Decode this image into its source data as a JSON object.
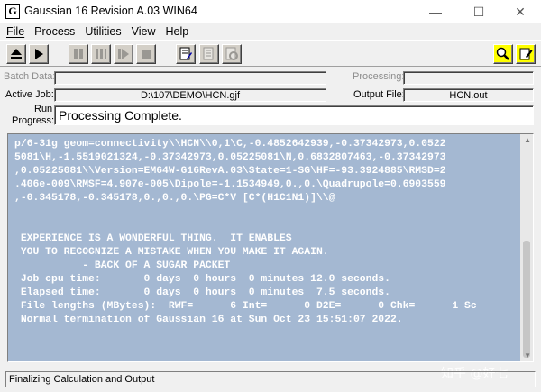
{
  "window": {
    "icon_glyph": "G",
    "title": "Gaussian 16 Revision A.03 WIN64",
    "minimize_glyph": "—",
    "maximize_glyph": "☐",
    "close_glyph": "✕"
  },
  "menu": [
    {
      "label": "File"
    },
    {
      "label": "Process"
    },
    {
      "label": "Utilities"
    },
    {
      "label": "View"
    },
    {
      "label": "Help"
    }
  ],
  "toolbar": {
    "icons": [
      "eject-icon",
      "play-icon",
      "pause-icon",
      "pause-after-icon",
      "skip-icon",
      "stop-icon",
      "edit-route-icon",
      "edit-batch-icon",
      "edit-config-icon",
      "search-icon",
      "edit-note-icon"
    ]
  },
  "fields": {
    "batch_data_label": "Batch Data:",
    "batch_data_value": "",
    "processing_label": "Processing:",
    "processing_value": "",
    "active_job_label": "Active Job:",
    "active_job_value": "D:\\107\\DEMO\\HCN.gjf",
    "output_file_label": "Output File:",
    "output_file_value": "HCN.out",
    "run_progress_label_1": "Run",
    "run_progress_label_2": "Progress:",
    "run_progress_value": "Processing Complete."
  },
  "output": {
    "lines": [
      "p/6-31g geom=connectivity\\\\HCN\\\\0,1\\C,-0.4852642939,-0.37342973,0.0522",
      "5081\\H,-1.5519021324,-0.37342973,0.05225081\\N,0.6832807463,-0.37342973",
      ",0.05225081\\\\Version=EM64W-G16RevA.03\\State=1-SG\\HF=-93.3924885\\RMSD=2",
      ".406e-009\\RMSF=4.907e-005\\Dipole=-1.1534949,0.,0.\\Quadrupole=0.6903559",
      ",-0.345178,-0.345178,0.,0.,0.\\PG=C*V [C*(H1C1N1)]\\\\@",
      "",
      "",
      " EXPERIENCE IS A WONDERFUL THING.  IT ENABLES",
      " YOU TO RECOGNIZE A MISTAKE WHEN YOU MAKE IT AGAIN.",
      "           - BACK OF A SUGAR PACKET",
      " Job cpu time:       0 days  0 hours  0 minutes 12.0 seconds.",
      " Elapsed time:       0 days  0 hours  0 minutes  7.5 seconds.",
      " File lengths (MBytes):  RWF=      6 Int=      0 D2E=      0 Chk=      1 Sc",
      " Normal termination of Gaussian 16 at Sun Oct 23 15:51:07 2022."
    ]
  },
  "status": "Finalizing Calculation and Output",
  "watermark": "知乎 @好七"
}
